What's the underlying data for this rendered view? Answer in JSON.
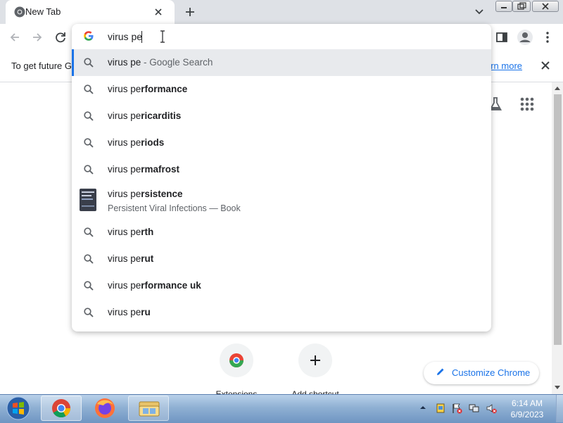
{
  "tab": {
    "title": "New Tab"
  },
  "omnibox": {
    "typed": "virus pe"
  },
  "suggestions": [
    {
      "prefix": "virus pe",
      "bold": "",
      "suffix": " - Google Search"
    },
    {
      "prefix": "virus pe",
      "bold": "rformance"
    },
    {
      "prefix": "virus pe",
      "bold": "ricarditis"
    },
    {
      "prefix": "virus pe",
      "bold": "riods"
    },
    {
      "prefix": "virus pe",
      "bold": "rmafrost"
    },
    {
      "prefix": "virus pe",
      "bold": "rsistence",
      "subtitle": "Persistent Viral Infections — Book"
    },
    {
      "prefix": "virus pe",
      "bold": "rth"
    },
    {
      "prefix": "virus pe",
      "bold": "rut"
    },
    {
      "prefix": "virus pe",
      "bold": "rformance uk"
    },
    {
      "prefix": "virus pe",
      "bold": "ru"
    }
  ],
  "infobar": {
    "text": "To get future G",
    "link": "arn more"
  },
  "shortcuts": [
    {
      "label": "Extensions"
    },
    {
      "label": "Add shortcut"
    }
  ],
  "customize": {
    "label": "Customize Chrome"
  },
  "taskbar": {
    "time": "6:14 AM",
    "date": "6/9/2023"
  },
  "colors": {
    "accent": "#1a73e8",
    "tabstrip": "#dee1e6",
    "selected_row": "#e8eaed"
  }
}
